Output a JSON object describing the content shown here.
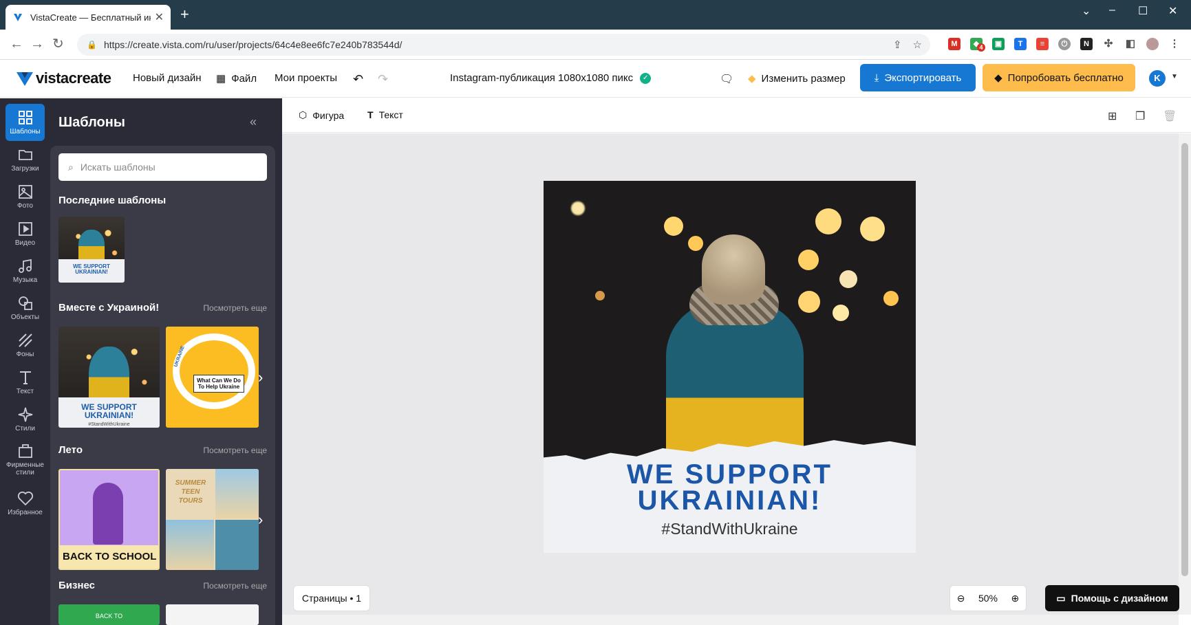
{
  "browser": {
    "tab_title": "VistaCreate — Бесплатный инст",
    "url": "https://create.vista.com/ru/user/projects/64c4e8ee6fc7e240b783544d/",
    "ext_badge": "4"
  },
  "header": {
    "logo": "vistacreate",
    "new_design": "Новый дизайн",
    "file": "Файл",
    "my_projects": "Мои проекты",
    "doc_title": "Instagram-публикация 1080x1080  пикс",
    "resize": "Изменить размер",
    "export": "Экспортировать",
    "try_free": "Попробовать бесплатно",
    "avatar_letter": "K"
  },
  "rail": {
    "items": [
      {
        "label": "Шаблоны",
        "icon": "templates-icon"
      },
      {
        "label": "Загрузки",
        "icon": "folder-icon"
      },
      {
        "label": "Фото",
        "icon": "image-icon"
      },
      {
        "label": "Видео",
        "icon": "video-icon"
      },
      {
        "label": "Музыка",
        "icon": "music-icon"
      },
      {
        "label": "Объекты",
        "icon": "objects-icon"
      },
      {
        "label": "Фоны",
        "icon": "backgrounds-icon"
      },
      {
        "label": "Текст",
        "icon": "text-icon"
      },
      {
        "label": "Стили",
        "icon": "styles-icon"
      },
      {
        "label": "Фирменные стили",
        "icon": "brand-icon"
      },
      {
        "label": "Избранное",
        "icon": "heart-icon"
      }
    ]
  },
  "panel": {
    "title": "Шаблоны",
    "search_placeholder": "Искать шаблоны",
    "recent_title": "Последние шаблоны",
    "see_more": "Посмотреть еще",
    "sections": [
      {
        "title": "Вместе с Украиной!"
      },
      {
        "title": "Лето"
      },
      {
        "title": "Бизнес"
      }
    ],
    "thumb_texts": {
      "support": "WE SUPPORT UKRAINIAN!",
      "hashtag": "#StandWithUkraine",
      "what_can": "What Can We Do To Help Ukraine",
      "ukraine_ring": "UKRAINE",
      "back_to_school": "BACK TO SCHOOL",
      "summer_tours": "SUMMER TEEN TOURS",
      "back_to": "BACK TO"
    }
  },
  "toolbar": {
    "shape": "Фигура",
    "text": "Текст"
  },
  "design": {
    "headline_1": "WE SUPPORT",
    "headline_2": "UKRAINIAN!",
    "hashtag": "#StandWithUkraine"
  },
  "bottom": {
    "pages": "Страницы • 1",
    "zoom": "50%",
    "help": "Помощь с дизайном"
  },
  "colors": {
    "accent": "#1778d3",
    "try_button": "#fdbc4b",
    "rail_bg": "#2a2b36",
    "headline": "#1b56a8"
  }
}
